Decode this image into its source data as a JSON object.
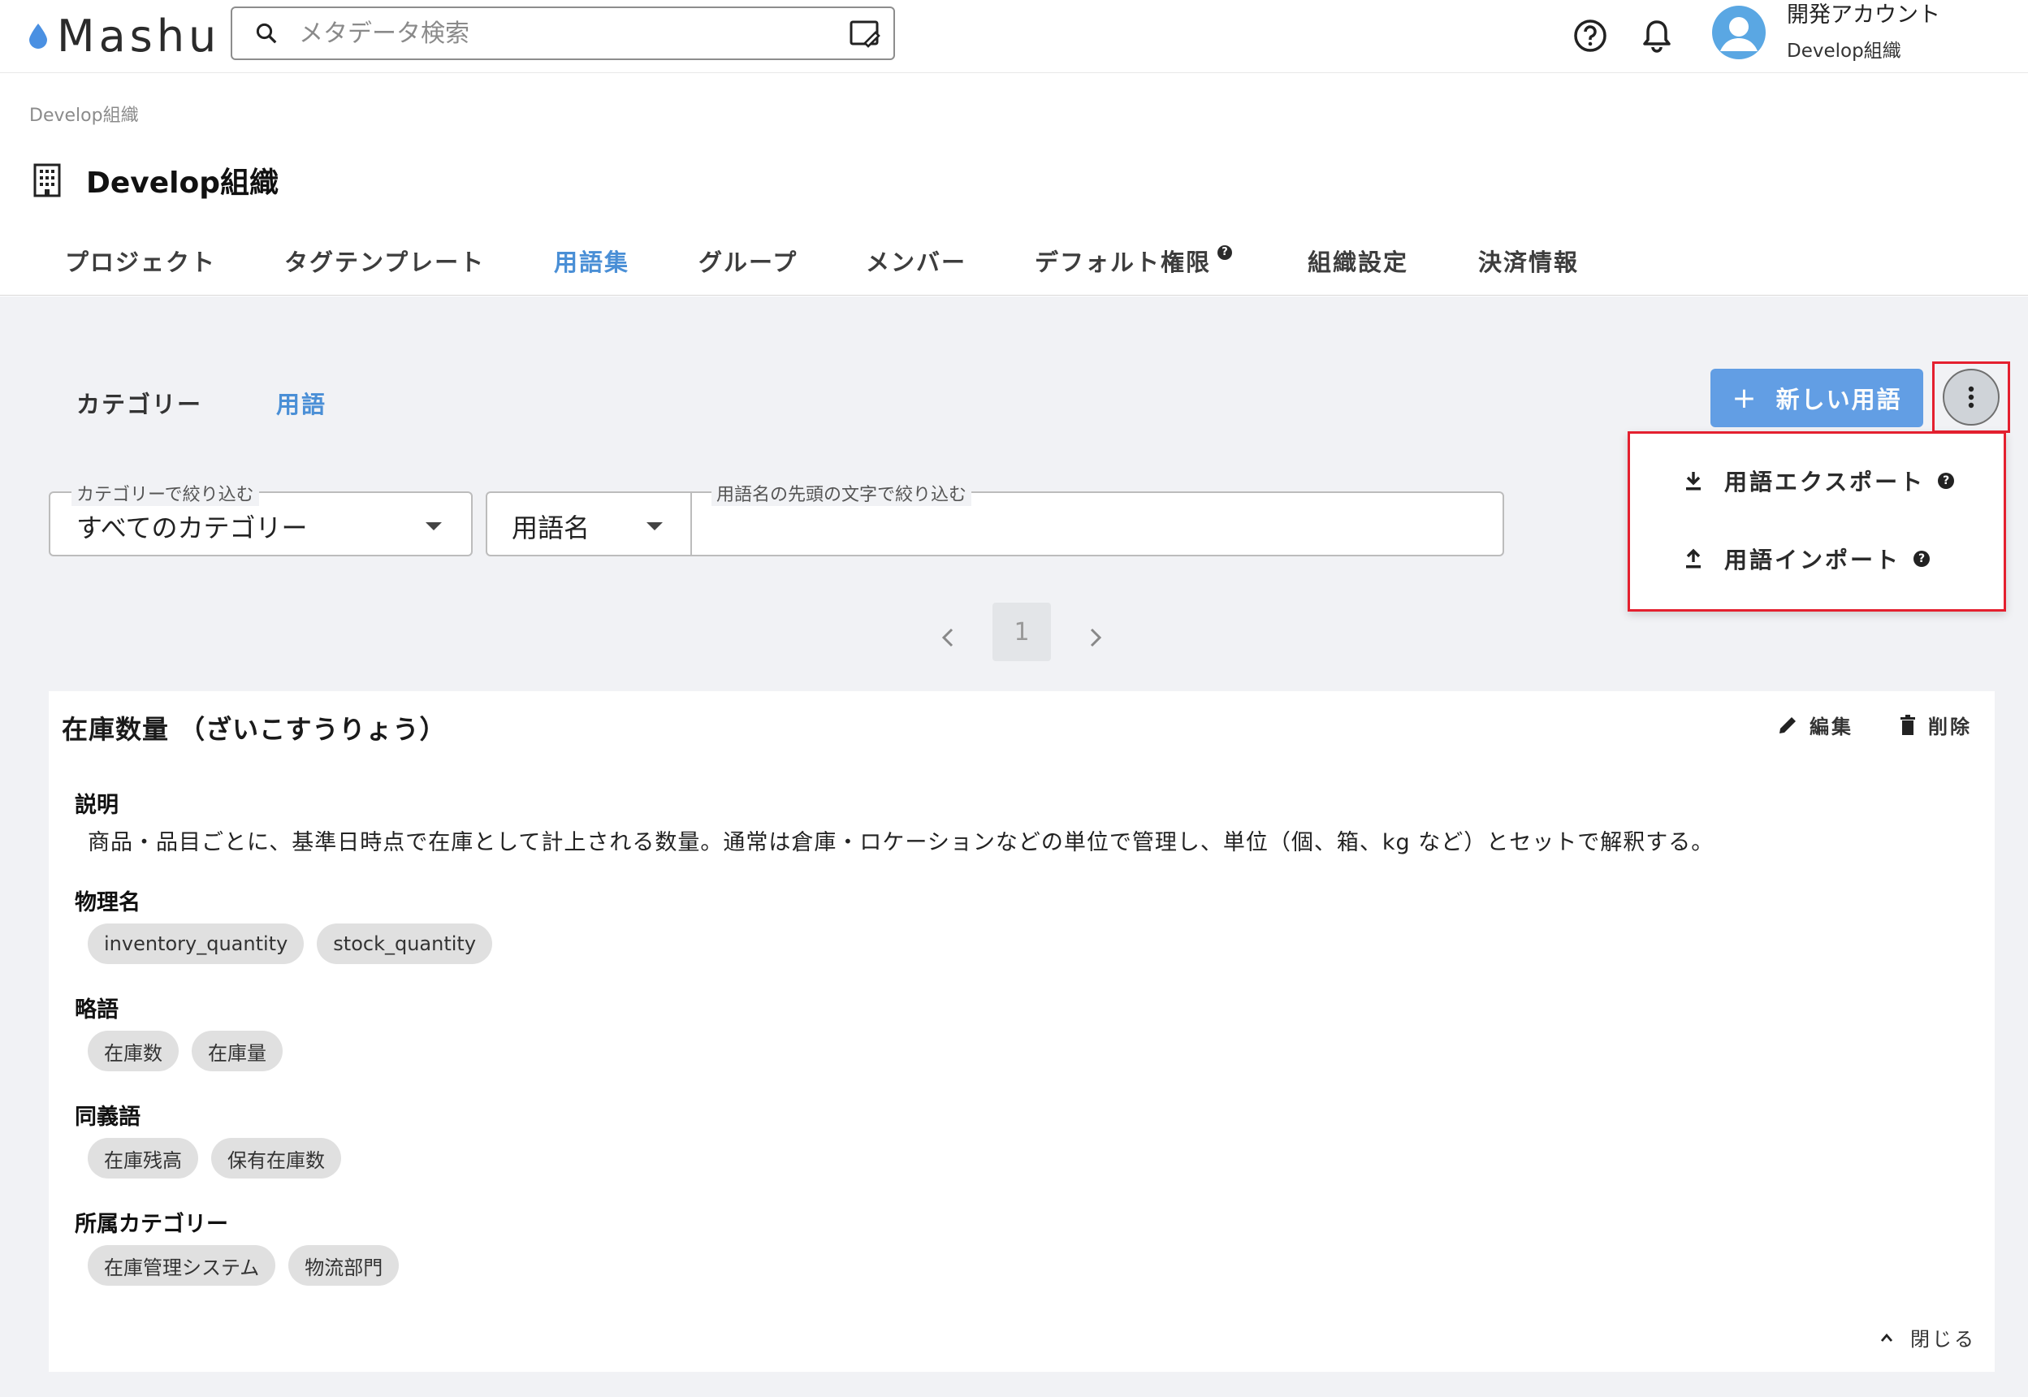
{
  "app": {
    "name": "Mashu"
  },
  "search": {
    "placeholder": "メタデータ検索"
  },
  "account": {
    "name": "開発アカウント",
    "org": "Develop組織"
  },
  "breadcrumb": "Develop組織",
  "org_title": "Develop組織",
  "tabs": [
    "プロジェクト",
    "タグテンプレート",
    "用語集",
    "グループ",
    "メンバー",
    "デフォルト権限",
    "組織設定",
    "決済情報"
  ],
  "active_tab": "用語集",
  "subtabs": [
    "カテゴリー",
    "用語"
  ],
  "active_subtab": "用語",
  "new_term_button": "新しい用語",
  "menu": {
    "export": "用語エクスポート",
    "import": "用語インポート"
  },
  "filters": {
    "category_legend": "カテゴリーで絞り込む",
    "category_value": "すべてのカテゴリー",
    "field_value": "用語名",
    "prefix_legend": "用語名の先頭の文字で絞り込む",
    "prefix_value": ""
  },
  "pagination": {
    "current": "1"
  },
  "term": {
    "title": "在庫数量 （ざいこすうりょう）",
    "edit": "編集",
    "delete": "削除",
    "description_label": "説明",
    "description": "商品・品目ごとに、基準日時点で在庫として計上される数量。通常は倉庫・ロケーションなどの単位で管理し、単位（個、箱、kg など）とセットで解釈する。",
    "physical_label": "物理名",
    "physical": [
      "inventory_quantity",
      "stock_quantity"
    ],
    "abbr_label": "略語",
    "abbr": [
      "在庫数",
      "在庫量"
    ],
    "synonym_label": "同義語",
    "synonyms": [
      "在庫残高",
      "保有在庫数"
    ],
    "category_label": "所属カテゴリー",
    "categories": [
      "在庫管理システム",
      "物流部門"
    ],
    "close": "閉じる"
  },
  "colors": {
    "accent": "#4a8fd6",
    "button": "#4a90e2",
    "highlight": "#e4202f",
    "background": "#f1f2f5"
  },
  "icons": [
    "water-drop-icon",
    "search-icon",
    "edit-note-icon",
    "help-icon",
    "bell-icon",
    "avatar-icon",
    "building-icon",
    "plus-icon",
    "more-vert-icon",
    "download-icon",
    "upload-icon",
    "chevron-left-icon",
    "chevron-right-icon",
    "pencil-icon",
    "trash-icon",
    "chevron-up-icon"
  ]
}
